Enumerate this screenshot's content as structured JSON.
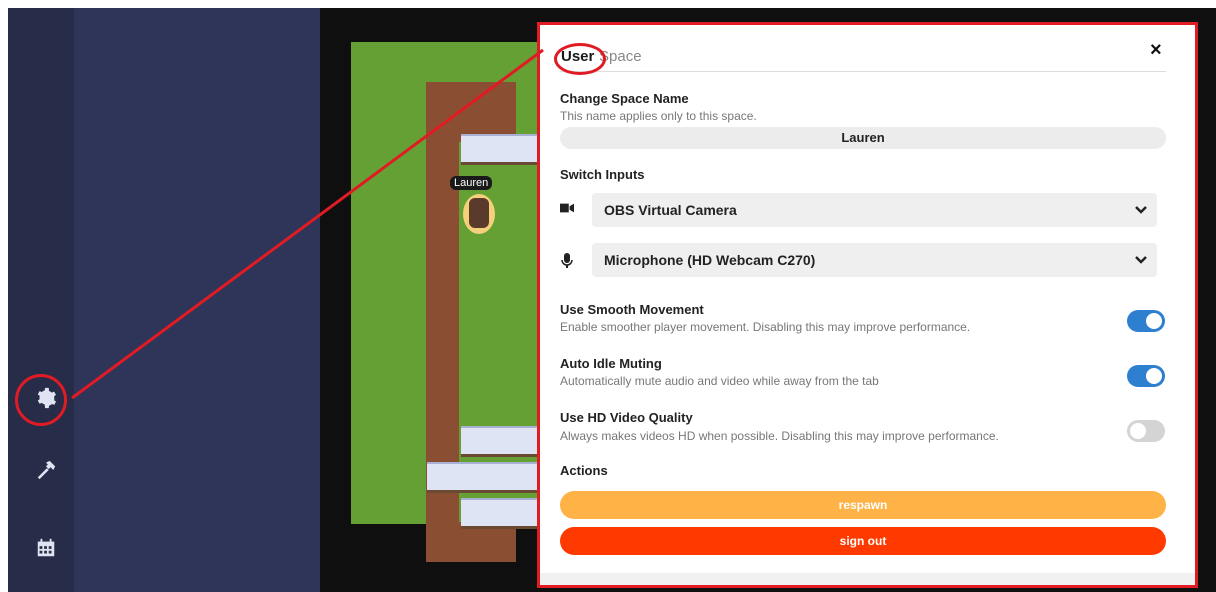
{
  "sidebar": {
    "icons": [
      "gear-icon",
      "hammer-icon",
      "calendar-icon"
    ]
  },
  "game": {
    "avatar_name": "Lauren"
  },
  "settings": {
    "tabs": {
      "user": "User",
      "space": "Space"
    },
    "close_label": "×",
    "change_name": {
      "title": "Change Space Name",
      "subtitle": "This name applies only to this space.",
      "value": "Lauren"
    },
    "switch_inputs": {
      "title": "Switch Inputs",
      "camera": "OBS Virtual Camera",
      "microphone": "Microphone (HD Webcam C270)"
    },
    "smooth_movement": {
      "title": "Use Smooth Movement",
      "subtitle": "Enable smoother player movement. Disabling this may improve performance.",
      "enabled": true
    },
    "auto_idle": {
      "title": "Auto Idle Muting",
      "subtitle": "Automatically mute audio and video while away from the tab",
      "enabled": true
    },
    "hd_video": {
      "title": "Use HD Video Quality",
      "subtitle": "Always makes videos HD when possible. Disabling this may improve performance.",
      "enabled": false
    },
    "actions": {
      "title": "Actions",
      "respawn": "respawn",
      "sign_out": "sign out"
    }
  },
  "colors": {
    "accent_blue": "#2f7fd0",
    "respawn": "#ffb347",
    "sign_out": "#ff3a00",
    "annotation": "#e01b24"
  }
}
